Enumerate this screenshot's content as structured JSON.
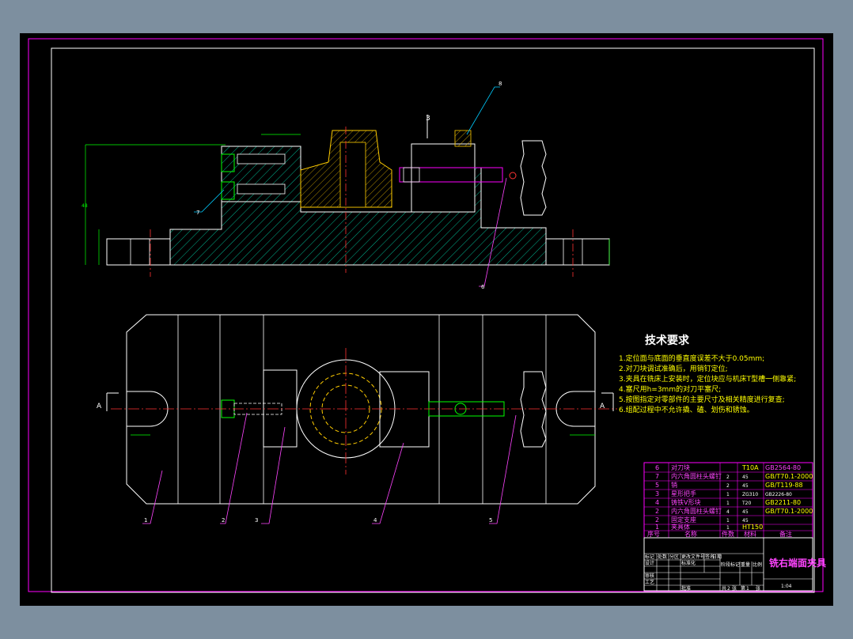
{
  "tech_requirements": {
    "title": "技术要求",
    "items": [
      "1.定位面与底面的垂直度误差不大于0.05mm;",
      "2.对刀块调试准确后，用销钉定位;",
      "3.夹具在铣床上安装时，定位块应与机床T型槽一侧靠紧;",
      "4.塞尺用h=3mm的对刀平塞尺;",
      "5.按图指定对零部件的主要尺寸及相关精度进行复查;",
      "6.组配过程中不允许撬、磕、划伤和锈蚀。"
    ]
  },
  "parts_list": {
    "rows": [
      {
        "no": "6",
        "name": "对刀块",
        "qty": "",
        "material": "T10A",
        "standard": "GB2564-80"
      },
      {
        "no": "7",
        "name": "内六角圆柱头螺钉",
        "qty": "2",
        "material": "45",
        "standard": "GB/T70.1-2000"
      },
      {
        "no": "5",
        "name": "销",
        "qty": "2",
        "material": "45",
        "standard": "GB/T119-88"
      },
      {
        "no": "3",
        "name": "星形把手",
        "qty": "1",
        "material": "ZG310",
        "standard": "GB2226-80"
      },
      {
        "no": "4",
        "name": "铸铁V形块",
        "qty": "1",
        "material": "T20",
        "standard": "GB2211-80"
      },
      {
        "no": "2",
        "name": "内六角圆柱头螺钉",
        "qty": "4",
        "material": "45",
        "standard": "GB/T70.1-2000"
      },
      {
        "no": "2",
        "name": "固定支座",
        "qty": "1",
        "material": "45",
        "standard": ""
      },
      {
        "no": "1",
        "name": "夹具体",
        "qty": "1",
        "material": "HT150",
        "standard": ""
      }
    ],
    "header": [
      "序号",
      "名称",
      "件数",
      "材料",
      "备注"
    ]
  },
  "title_block": {
    "drawing_name": "铣右端面夹具",
    "scale": "1:04",
    "sheet": "1",
    "sheets": "2",
    "labels": [
      "标记",
      "处数",
      "分区",
      "更改文件号",
      "签名",
      "日期",
      "设计",
      "标准化",
      "阶段标记",
      "重量",
      "比例",
      "审核",
      "工艺",
      "批准",
      "共",
      "张",
      "第",
      "张"
    ]
  },
  "section_label": "A",
  "callouts": [
    "1",
    "2",
    "3",
    "4",
    "5",
    "6",
    "7"
  ],
  "colors": {
    "background": "#000000",
    "frame": "#ff00ff",
    "outline": "#ffffff",
    "hatch": "#00ffcc",
    "dimension": "#00ff00",
    "center": "#ff3333",
    "part_yellow": "#ffcc00",
    "leader": "#00ccff"
  }
}
